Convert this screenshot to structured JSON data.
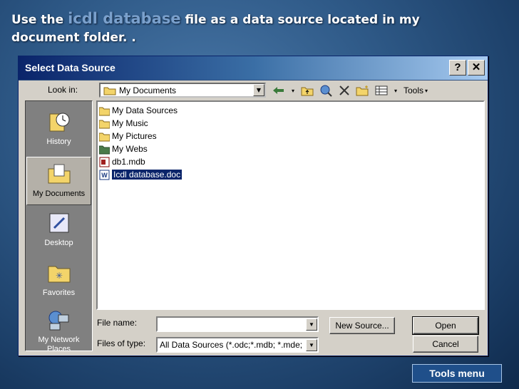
{
  "caption": {
    "before": "Use the ",
    "highlight": "icdl database",
    "after": " file as a data source located in my document folder. ."
  },
  "dialog": {
    "title": "Select Data Source",
    "help_label": "?",
    "close_label": "✕",
    "look_in_label": "Look in:",
    "look_in_value": "My Documents",
    "tools_label": "Tools"
  },
  "places": [
    {
      "label": "History",
      "icon": "history-icon"
    },
    {
      "label": "My Documents",
      "icon": "my-documents-icon"
    },
    {
      "label": "Desktop",
      "icon": "desktop-icon"
    },
    {
      "label": "Favorites",
      "icon": "favorites-icon"
    },
    {
      "label": "My Network Places",
      "icon": "network-places-icon"
    }
  ],
  "files": [
    {
      "name": "My Data Sources",
      "icon": "folder-icon"
    },
    {
      "name": "My Music",
      "icon": "folder-icon"
    },
    {
      "name": "My Pictures",
      "icon": "folder-icon"
    },
    {
      "name": "My Webs",
      "icon": "folder-icon"
    },
    {
      "name": "db1.mdb",
      "icon": "access-file-icon"
    },
    {
      "name": "Icdl database.doc",
      "icon": "word-file-icon",
      "selected": true
    }
  ],
  "file_name": {
    "label": "File name:",
    "value": ""
  },
  "file_type": {
    "label": "Files of type:",
    "value": "All Data Sources (*.odc;*.mdb; *.mde;"
  },
  "buttons": {
    "new_source": "New Source...",
    "open": "Open",
    "cancel": "Cancel"
  },
  "annotation": "Tools menu",
  "colors": {
    "selection": "#0a246a",
    "titlebar": "#0a246a",
    "dialog_bg": "#d4d0c8"
  }
}
